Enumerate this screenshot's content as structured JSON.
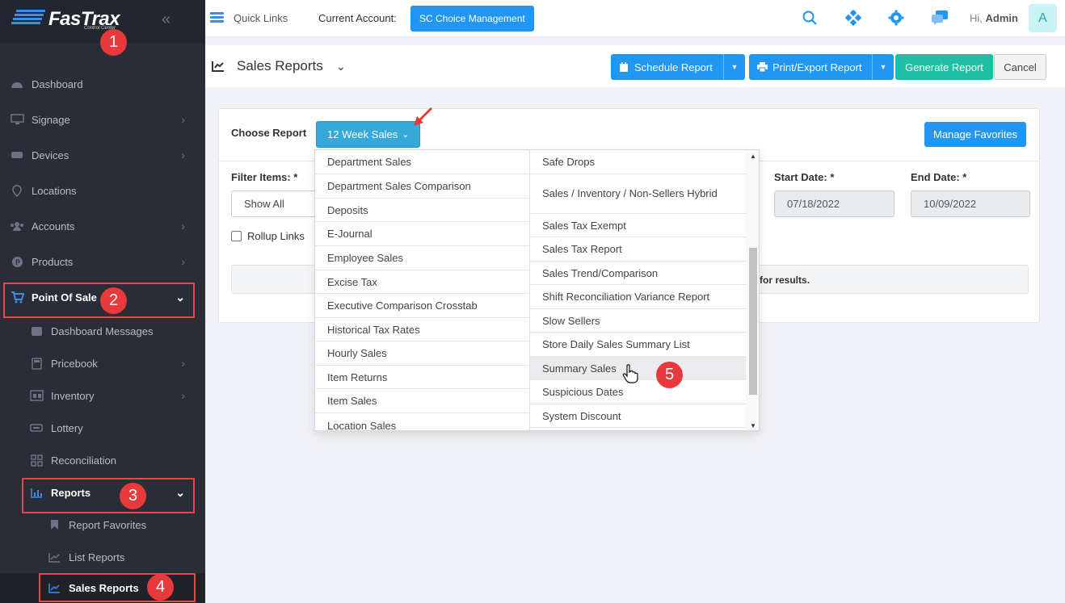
{
  "brand": {
    "name": "FasTrax",
    "sub": "Control Center"
  },
  "sidebar": {
    "items": [
      {
        "label": "Dashboard"
      },
      {
        "label": "Signage"
      },
      {
        "label": "Devices"
      },
      {
        "label": "Locations"
      },
      {
        "label": "Accounts"
      },
      {
        "label": "Products"
      },
      {
        "label": "Point Of Sale"
      },
      {
        "label": "Dashboard Messages"
      },
      {
        "label": "Pricebook"
      },
      {
        "label": "Inventory"
      },
      {
        "label": "Lottery"
      },
      {
        "label": "Reconciliation"
      },
      {
        "label": "Reports"
      },
      {
        "label": "Report Favorites"
      },
      {
        "label": "List Reports"
      },
      {
        "label": "Sales Reports"
      }
    ]
  },
  "badges": [
    "1",
    "2",
    "3",
    "4",
    "5"
  ],
  "topbar": {
    "quick_links": "Quick Links",
    "current_account_label": "Current Account:",
    "current_account": "SC Choice Management",
    "greeting": "Hi, ",
    "user": "Admin",
    "avatar_letter": "A"
  },
  "page": {
    "title": "Sales Reports",
    "schedule": "Schedule Report",
    "print": "Print/Export Report",
    "generate": "Generate Report",
    "cancel": "Cancel"
  },
  "form": {
    "choose_report_label": "Choose Report",
    "choose_report_value": "12 Week Sales",
    "manage_favorites": "Manage Favorites",
    "filter_items_label": "Filter Items: *",
    "filter_items_value": "Show All",
    "start_date_label": "Start Date: *",
    "start_date": "07/18/2022",
    "end_date_label": "End Date: *",
    "end_date": "10/09/2022",
    "rollup_links": "Rollup Links",
    "result_hint": "e for results."
  },
  "dropdown": {
    "left": [
      "Department Sales",
      "Department Sales Comparison",
      "Deposits",
      "E-Journal",
      "Employee Sales",
      "Excise Tax",
      "Executive Comparison Crosstab",
      "Historical Tax Rates",
      "Hourly Sales",
      "Item Returns",
      "Item Sales",
      "Location Sales"
    ],
    "right": [
      "Safe Drops",
      "Sales / Inventory / Non-Sellers Hybrid",
      "Sales Tax Exempt",
      "Sales Tax Report",
      "Sales Trend/Comparison",
      "Shift Reconciliation Variance Report",
      "Slow Sellers",
      "Store Daily Sales Summary List",
      "Summary Sales",
      "Suspicious Dates",
      "System Discount"
    ]
  },
  "colors": {
    "accent": "#2196f3",
    "sidebar": "#2a2d36",
    "annotation": "#e5474b",
    "teal": "#1fbfa3"
  }
}
